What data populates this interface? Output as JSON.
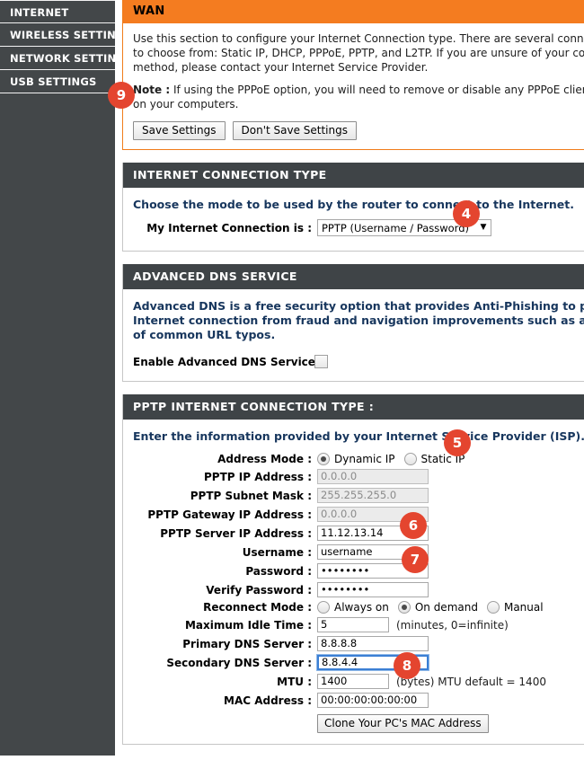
{
  "sidebar": {
    "items": [
      {
        "label": "INTERNET"
      },
      {
        "label": "WIRELESS SETTINGS"
      },
      {
        "label": "NETWORK SETTINGS"
      },
      {
        "label": "USB SETTINGS"
      }
    ]
  },
  "wan": {
    "title": "WAN",
    "intro_line1": "Use this section to configure your Internet Connection type. There are several connection types",
    "intro_line2": "to choose from: Static IP, DHCP, PPPoE, PPTP, and L2TP. If you are unsure of your connection",
    "intro_line3": "method, please contact your Internet Service Provider.",
    "note_label": "Note :",
    "note_line1": " If using the PPPoE option, you will need to remove or disable any PPPoE client software",
    "note_line2": "on your computers.",
    "save_label": "Save Settings",
    "dont_save_label": "Don't Save Settings"
  },
  "connection_type": {
    "title": "INTERNET CONNECTION TYPE",
    "lead": "Choose the mode to be used by the router to connect to the Internet.",
    "field_label": "My Internet Connection is :",
    "selected": "PPTP (Username / Password)",
    "arrow": "▼"
  },
  "advanced_dns": {
    "title": "ADVANCED DNS SERVICE",
    "lead_line1": "Advanced DNS is a free security option that provides Anti-Phishing to protect your",
    "lead_line2": "Internet connection from fraud and navigation improvements such as auto-correction",
    "lead_line3": "of common URL typos.",
    "enable_label": "Enable Advanced DNS Service :",
    "enabled": false
  },
  "pptp": {
    "title": "PPTP INTERNET CONNECTION TYPE :",
    "lead": "Enter the information provided by your Internet Service Provider (ISP).",
    "address_mode": {
      "label": "Address Mode :",
      "options": [
        {
          "label": "Dynamic IP",
          "selected": true
        },
        {
          "label": "Static IP",
          "selected": false
        }
      ]
    },
    "ip_address": {
      "label": "PPTP IP Address :",
      "value": "0.0.0.0",
      "readonly": true
    },
    "subnet_mask": {
      "label": "PPTP Subnet Mask :",
      "value": "255.255.255.0",
      "readonly": true
    },
    "gateway": {
      "label": "PPTP Gateway IP Address :",
      "value": "0.0.0.0",
      "readonly": true
    },
    "server_ip": {
      "label": "PPTP Server IP Address :",
      "value": "11.12.13.14",
      "readonly": false
    },
    "username": {
      "label": "Username :",
      "value": "username",
      "readonly": false
    },
    "password": {
      "label": "Password :",
      "value": "••••••••",
      "readonly": false
    },
    "verify_password": {
      "label": "Verify Password :",
      "value": "••••••••",
      "readonly": false
    },
    "reconnect_mode": {
      "label": "Reconnect Mode :",
      "options": [
        {
          "label": "Always on",
          "selected": false
        },
        {
          "label": "On demand",
          "selected": true
        },
        {
          "label": "Manual",
          "selected": false
        }
      ]
    },
    "max_idle_time": {
      "label": "Maximum Idle Time :",
      "value": "5",
      "hint": "(minutes, 0=infinite)"
    },
    "primary_dns": {
      "label": "Primary DNS Server :",
      "value": "8.8.8.8"
    },
    "secondary_dns": {
      "label": "Secondary DNS Server :",
      "value": "8.8.4.4",
      "focused": true
    },
    "mtu": {
      "label": "MTU :",
      "value": "1400",
      "hint": "(bytes) MTU default = 1400"
    },
    "mac_address": {
      "label": "MAC Address :",
      "value": "00:00:00:00:00:00"
    },
    "clone_label": "Clone Your PC's MAC Address"
  },
  "badges": {
    "b4": "4",
    "b5": "5",
    "b6": "6",
    "b7": "7",
    "b8": "8",
    "b9": "9"
  },
  "colors": {
    "accent_orange": "#f47c20",
    "header_dark": "#3f4447",
    "sidebar_dark": "#434749",
    "badge_red": "#e4452f",
    "lead_blue": "#17365d",
    "focus_blue": "#3b7fd4"
  }
}
